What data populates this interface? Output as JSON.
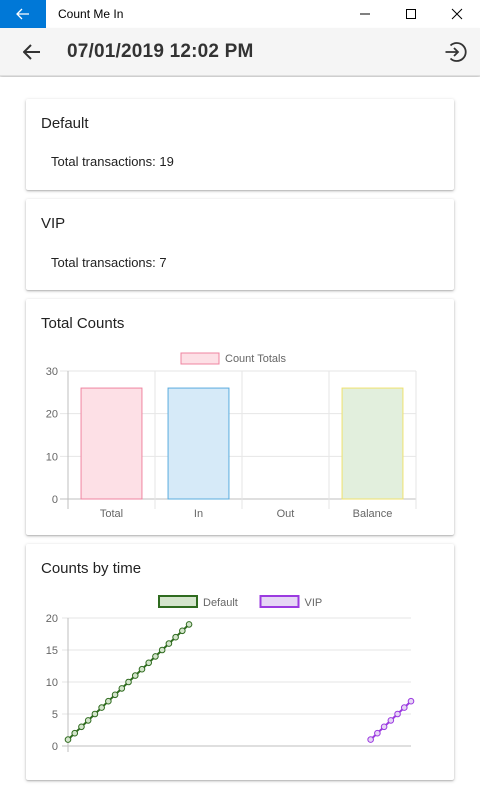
{
  "window": {
    "title": "Count Me In"
  },
  "header": {
    "datetime": "07/01/2019 12:02 PM"
  },
  "summaries": [
    {
      "title": "Default",
      "total_label": "Total transactions: 19"
    },
    {
      "title": "VIP",
      "total_label": "Total transactions: 7"
    }
  ],
  "colors": {
    "accent": "#0078d7"
  },
  "charts": {
    "total_counts": {
      "title": "Total Counts"
    },
    "counts_by_time": {
      "title": "Counts by time"
    }
  },
  "chart_data": [
    {
      "type": "bar",
      "title": "Total Counts",
      "legend_position": "top",
      "categories": [
        "Total",
        "In",
        "Out",
        "Balance"
      ],
      "series": [
        {
          "name": "Count Totals",
          "values": [
            26,
            26,
            0,
            26
          ]
        }
      ],
      "bar_fills": [
        "#fde0e6",
        "#d6eaf8",
        "#fef6de",
        "#e2efdd"
      ],
      "bar_strokes": [
        "#ef84a0",
        "#5aacde",
        "#f3c65a",
        "#efe26e"
      ],
      "legend_fill": "#fde0e6",
      "legend_stroke": "#ef84a0",
      "yticks": [
        0,
        10,
        20,
        30
      ],
      "ylim": [
        0,
        30
      ],
      "grid": true
    },
    {
      "type": "line",
      "title": "Counts by time",
      "legend_position": "top",
      "yticks": [
        0,
        5,
        10,
        15,
        20
      ],
      "ylim": [
        0,
        20
      ],
      "grid": true,
      "series": [
        {
          "name": "Default",
          "color": "#2f6b1f",
          "legend_fill": "#d4e5cc",
          "x": [
            0,
            1,
            2,
            3,
            4,
            5,
            6,
            7,
            8,
            9,
            10,
            11,
            12,
            13,
            14,
            15,
            16,
            17,
            18
          ],
          "y": [
            1,
            2,
            3,
            4,
            5,
            6,
            7,
            8,
            9,
            10,
            11,
            12,
            13,
            14,
            15,
            16,
            17,
            18,
            19
          ]
        },
        {
          "name": "VIP",
          "color": "#9b3ae0",
          "legend_fill": "#e6d6f5",
          "x": [
            45,
            46,
            47,
            48,
            49,
            50,
            51
          ],
          "y": [
            1,
            2,
            3,
            4,
            5,
            6,
            7
          ]
        }
      ],
      "xrange": [
        0,
        51
      ]
    }
  ]
}
